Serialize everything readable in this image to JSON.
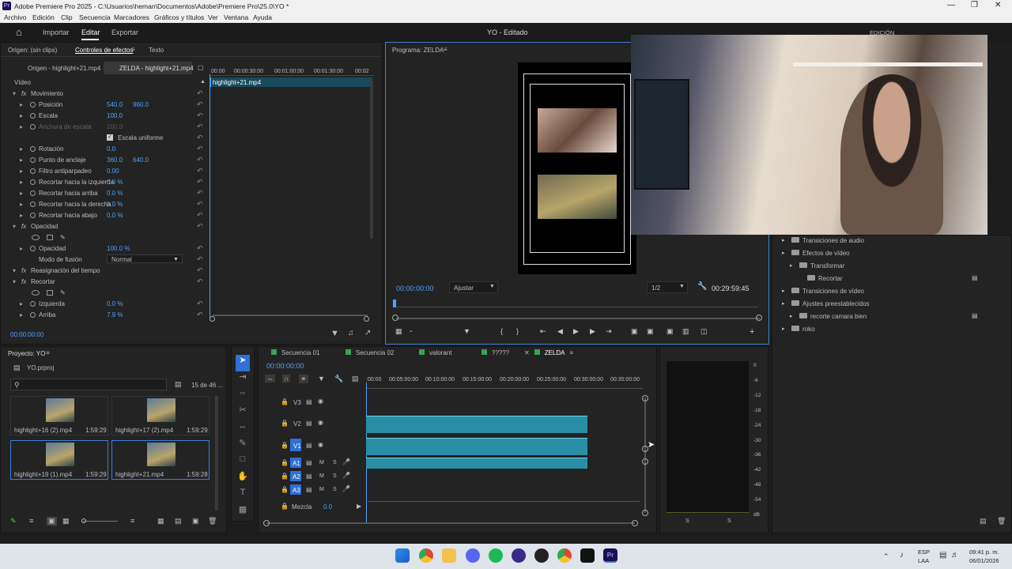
{
  "titlebar": {
    "title": "Adobe Premiere Pro 2025 - C:\\Usuarios\\heman\\Documentos\\Adobe\\Premiere Pro\\25.0\\YO *"
  },
  "menu": [
    "Archivo",
    "Edición",
    "Clip",
    "Secuencia",
    "Marcadores",
    "Gráficos y títulos",
    "Ver",
    "Ventana",
    "Ayuda"
  ],
  "workspace": {
    "tabs": [
      "Importar",
      "Editar",
      "Exportar"
    ],
    "title": "YO - Editado",
    "active_right": "EDICIÓN"
  },
  "effect_controls": {
    "tabs": [
      "Origen: (sin clips)",
      "Controles de efectos",
      "Texto"
    ],
    "subtabs": [
      "Origen - highlight+21.mp4",
      "ZELDA - highlight+21.mp4"
    ],
    "ruler": [
      "00:00",
      "00:00:30:00",
      "00:01:00:00",
      "00:01:30:00",
      "00:02"
    ],
    "clip_name": "highlight+21.mp4",
    "section_video": "Vídeo",
    "rows": [
      {
        "name": "Movimiento",
        "type": "fx"
      },
      {
        "name": "Posición",
        "v1": "540.0",
        "v2": "960.0"
      },
      {
        "name": "Escala",
        "v1": "100.0"
      },
      {
        "name": "Anchura de escala",
        "v1": "100.0",
        "dim": true
      },
      {
        "name": "Escala uniforme",
        "type": "check"
      },
      {
        "name": "Rotación",
        "v1": "0.0"
      },
      {
        "name": "Punto de anclaje",
        "v1": "360.0",
        "v2": "640.0"
      },
      {
        "name": "Filtro antiparpadeo",
        "v1": "0.00"
      },
      {
        "name": "Recortar hacia la izquierda",
        "v1": "0.0 %"
      },
      {
        "name": "Recortar hacia arriba",
        "v1": "0.0 %"
      },
      {
        "name": "Recortar hacia la derecha",
        "v1": "0.0 %"
      },
      {
        "name": "Recortar hacia abajo",
        "v1": "0.0 %"
      },
      {
        "name": "Opacidad",
        "type": "fx"
      },
      {
        "name": "",
        "type": "masks"
      },
      {
        "name": "Opacidad",
        "v1": "100.0 %"
      },
      {
        "name": "Modo de fusión",
        "v1": "Normal",
        "type": "select"
      },
      {
        "name": "Reasignación del tiempo",
        "type": "fx"
      },
      {
        "name": "Recortar",
        "type": "fx"
      },
      {
        "name": "",
        "type": "masks"
      },
      {
        "name": "Izquierda",
        "v1": "0.0 %"
      },
      {
        "name": "Arriba",
        "v1": "7.9 %"
      }
    ],
    "timecode": "00:00:00:00"
  },
  "program": {
    "title": "Programa: ZELDA",
    "timecode": "00:00:00:00",
    "fit": "Ajustar",
    "resolution": "1/2",
    "duration": "00:29:59:45"
  },
  "effects_panel": {
    "items": [
      {
        "label": "Transiciones de audio",
        "level": 0
      },
      {
        "label": "Efectos de vídeo",
        "level": 0
      },
      {
        "label": "Transformar",
        "level": 1
      },
      {
        "label": "Recortar",
        "level": 2
      },
      {
        "label": "Transiciones de vídeo",
        "level": 0
      },
      {
        "label": "Ajustes preestablecidos",
        "level": 0
      },
      {
        "label": "recorte camara bien",
        "level": 1
      },
      {
        "label": "roko",
        "level": 0
      }
    ]
  },
  "project": {
    "title": "Proyecto: YO",
    "file": "YO.prproj",
    "count": "15 de 46 ...",
    "clips": [
      {
        "name": "highlight+16 (2).mp4",
        "duration": "1:59:29"
      },
      {
        "name": "highlight+17 (2).mp4",
        "duration": "1:59:29"
      },
      {
        "name": "highlight+19 (1).mp4",
        "duration": "1:59:29"
      },
      {
        "name": "highlight+21.mp4",
        "duration": "1:59:28"
      }
    ]
  },
  "timeline": {
    "tabs": [
      "Secuencia 01",
      "Secuencia 02",
      "valorant",
      "?????",
      "ZELDA"
    ],
    "tab_colors": [
      "#3aa05a",
      "#3aa05a",
      "#3aa05a",
      "#3aa05a",
      "#3aa05a"
    ],
    "timecode": "00:00:00:00",
    "ruler": [
      ":00:00",
      "00:05:00:00",
      "00:10:00:00",
      "00:15:00:00",
      "00:20:00:00",
      "00:25:00:00",
      "00:30:00:00",
      "00:35:00:00"
    ],
    "video_tracks": [
      "V3",
      "V2",
      "V1"
    ],
    "audio_tracks": [
      "A1",
      "A2",
      "A3"
    ],
    "mix_label": "Mezcla",
    "mix_value": "0.0",
    "ms": [
      "M",
      "S"
    ]
  },
  "meter": {
    "scale": [
      "0",
      "-6",
      "-12",
      "-18",
      "-24",
      "-30",
      "-36",
      "-42",
      "-48",
      "-54",
      "dB"
    ],
    "bottom": [
      "S",
      "S"
    ]
  },
  "taskbar": {
    "lang": "ESP",
    "region": "LAA",
    "time": "09:41 p. m.",
    "date": "06/01/2026"
  }
}
